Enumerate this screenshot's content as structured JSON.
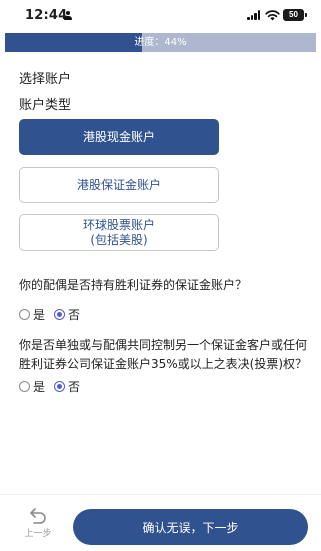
{
  "status_bar": {
    "time": "12:44",
    "battery": "50"
  },
  "progress": {
    "label": "进度：44%",
    "value": 0.44
  },
  "form": {
    "section_title": "选择账户",
    "account_type_label": "账户类型",
    "account_options": [
      {
        "label": "港股现金账户",
        "selected": true
      },
      {
        "label": "港股保证金账户",
        "selected": false
      },
      {
        "label": "环球股票账户",
        "sub_label": "(包括美股)",
        "selected": false
      }
    ],
    "question_1": "你的配偶是否持有胜利证券的保证金账户？",
    "question_1_options": {
      "yes": "是",
      "no": "否",
      "selected": "no"
    },
    "question_2": "你是否单独或与配偶共同控制另一个保证金客户或任何胜利证券公司保证金账户35%或以上之表决(投票)权？",
    "question_2_options": {
      "yes": "是",
      "no": "否",
      "selected": "no"
    }
  },
  "footer": {
    "back_label": "上一步",
    "submit_label": "确认无误，下一步"
  },
  "colors": {
    "primary": "#30528f",
    "progress_track": "#aeb7ce",
    "radio_checked": "#4d5bd6"
  }
}
